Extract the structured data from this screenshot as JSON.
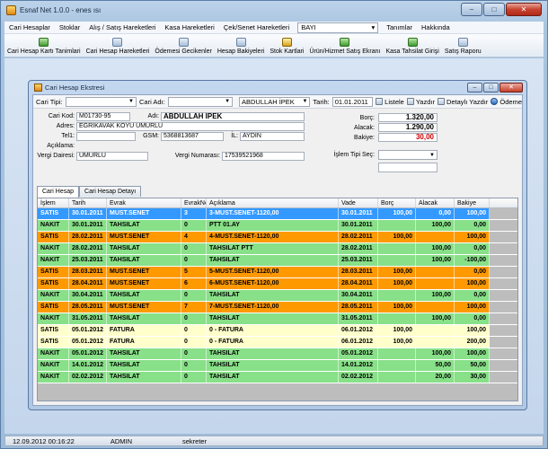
{
  "app": {
    "title": "Esnaf Net 1.0.0 - enes ısı"
  },
  "window_controls": {
    "min": "–",
    "max": "□",
    "close": "✕"
  },
  "menu": {
    "items": [
      "Cari Hesaplar",
      "Stoklar",
      "Alış / Satış Hareketleri",
      "Kasa Hareketleri",
      "Çek/Senet Hareketleri"
    ],
    "bayi_value": "BAYI",
    "items_right": [
      "Tanımlar",
      "Hakkında"
    ]
  },
  "toolbar": {
    "buttons": [
      {
        "label": "Cari Hesap Kartı Tanimlari",
        "icon": "user-add-icon"
      },
      {
        "label": "Cari Hesap Hareketleri",
        "icon": "ledger-icon"
      },
      {
        "label": "Ödemesi Gecikenler",
        "icon": "clock-icon"
      },
      {
        "label": "Hesap Bakiyeleri",
        "icon": "balance-icon"
      },
      {
        "label": "Stok Kartlari",
        "icon": "box-icon"
      },
      {
        "label": "Ürün/Hizmet Satış Ekranı",
        "icon": "cart-icon"
      },
      {
        "label": "Kasa Tahsilat Girişi",
        "icon": "cash-icon"
      },
      {
        "label": "Satış Raporu",
        "icon": "report-icon"
      }
    ]
  },
  "child_window": {
    "title": "Cari Hesap Ekstresi"
  },
  "filter": {
    "cari_tipi_label": "Cari Tipi:",
    "cari_tipi_value": "",
    "cari_adi_label": "Cari Adı:",
    "cari_adi_value": "",
    "name_value": "ABDULLAH İPEK",
    "tarih_label": "Tarih:",
    "tarih_value": "01.01.2011",
    "listele": "Listele",
    "yazdir": "Yazdır",
    "detayli_yazdir": "Detaylı Yazdır",
    "odeme": "Ödeme"
  },
  "form": {
    "cari_kod_label": "Cari Kod:",
    "cari_kod": "M01730-95",
    "adi_label": "Adı:",
    "adi": "ABDULLAH İPEK",
    "adres_label": "Adres:",
    "adres": "EĞRİKAVAK KÖYÜ UMURLU",
    "tel1_label": "Tel1:",
    "tel1": "",
    "gsm_label": "GSM:",
    "gsm": "5368813687",
    "il_label": "İL:",
    "il": "AYDIN",
    "aciklama_label": "Açıklama:",
    "aciklama": "",
    "vergi_dairesi_label": "Vergi Dairesi:",
    "vergi_dairesi": "UMURLU",
    "vergi_numarasi_label": "Vergi Numarası:",
    "vergi_numarasi": "17539521968",
    "borc_label": "Borç:",
    "borc": "1.320,00",
    "alacak_label": "Alacak:",
    "alacak": "1.290,00",
    "bakiye_label": "Bakiye:",
    "bakiye": "30,00",
    "islem_tipi_label": "İşlem Tipi Seç:",
    "islem_tipi": ""
  },
  "tabs": [
    "Cari Hesap",
    "Cari Hesap Detayı"
  ],
  "grid": {
    "headers": [
      "İşlem",
      "Tarih",
      "Evrak",
      "EvrakNo",
      "Açıklama",
      "Vade",
      "Borç",
      "Alacak",
      "Bakiye"
    ],
    "rows": [
      {
        "c": [
          "SATIS",
          "30.01.2011",
          "MUST.SENET",
          "3",
          "3-MUST.SENET-1120,00",
          "30.01.2011",
          "100,00",
          "0,00",
          "100,00"
        ],
        "s": "blue"
      },
      {
        "c": [
          "NAKIT",
          "30.01.2011",
          "TAHSILAT",
          "0",
          "PTT 01.AY",
          "30.01.2011",
          "",
          "100,00",
          "0,00"
        ],
        "s": "green"
      },
      {
        "c": [
          "SATIS",
          "28.02.2011",
          "MUST.SENET",
          "4",
          "4-MUST.SENET-1120,00",
          "28.02.2011",
          "100,00",
          "",
          "100,00"
        ],
        "s": "orange"
      },
      {
        "c": [
          "NAKIT",
          "28.02.2011",
          "TAHSILAT",
          "0",
          "TAHSILAT PTT",
          "28.02.2011",
          "",
          "100,00",
          "0,00"
        ],
        "s": "green"
      },
      {
        "c": [
          "NAKIT",
          "25.03.2011",
          "TAHSILAT",
          "0",
          "TAHSILAT",
          "25.03.2011",
          "",
          "100,00",
          "-100,00"
        ],
        "s": "green"
      },
      {
        "c": [
          "SATIS",
          "28.03.2011",
          "MUST.SENET",
          "5",
          "5-MUST.SENET-1120,00",
          "28.03.2011",
          "100,00",
          "",
          "0,00"
        ],
        "s": "orange"
      },
      {
        "c": [
          "SATIS",
          "28.04.2011",
          "MUST.SENET",
          "6",
          "6-MUST.SENET-1120,00",
          "28.04.2011",
          "100,00",
          "",
          "100,00"
        ],
        "s": "orange"
      },
      {
        "c": [
          "NAKIT",
          "30.04.2011",
          "TAHSILAT",
          "0",
          "TAHSILAT",
          "30.04.2011",
          "",
          "100,00",
          "0,00"
        ],
        "s": "green"
      },
      {
        "c": [
          "SATIS",
          "28.05.2011",
          "MUST.SENET",
          "7",
          "7-MUST.SENET-1120,00",
          "28.05.2011",
          "100,00",
          "",
          "100,00"
        ],
        "s": "orange"
      },
      {
        "c": [
          "NAKIT",
          "31.05.2011",
          "TAHSILAT",
          "0",
          "TAHSILAT",
          "31.05.2011",
          "",
          "100,00",
          "0,00"
        ],
        "s": "green"
      },
      {
        "c": [
          "SATIS",
          "05.01.2012",
          "FATURA",
          "0",
          "0 - FATURA",
          "06.01.2012",
          "100,00",
          "",
          "100,00"
        ],
        "s": "yellow"
      },
      {
        "c": [
          "SATIS",
          "05.01.2012",
          "FATURA",
          "0",
          "0 - FATURA",
          "06.01.2012",
          "100,00",
          "",
          "200,00"
        ],
        "s": "yellow"
      },
      {
        "c": [
          "NAKIT",
          "05.01.2012",
          "TAHSILAT",
          "0",
          "TAHSILAT",
          "05.01.2012",
          "",
          "100,00",
          "100,00"
        ],
        "s": "green"
      },
      {
        "c": [
          "NAKIT",
          "14.01.2012",
          "TAHSILAT",
          "0",
          "TAHSILAT",
          "14.01.2012",
          "",
          "50,00",
          "50,00"
        ],
        "s": "green"
      },
      {
        "c": [
          "NAKIT",
          "02.02.2012",
          "TAHSILAT",
          "0",
          "TAHSILAT",
          "02.02.2012",
          "",
          "20,00",
          "30,00"
        ],
        "s": "green"
      }
    ]
  },
  "status": {
    "datetime": "12.09.2012 00:16:22",
    "user": "ADMIN",
    "password": "sekreter"
  },
  "colors": {
    "row_blue": "#3399ff",
    "row_green": "#88e088",
    "row_orange": "#ff9900",
    "row_yellow": "#ffffcc",
    "bakiye_red": "#d00000"
  }
}
